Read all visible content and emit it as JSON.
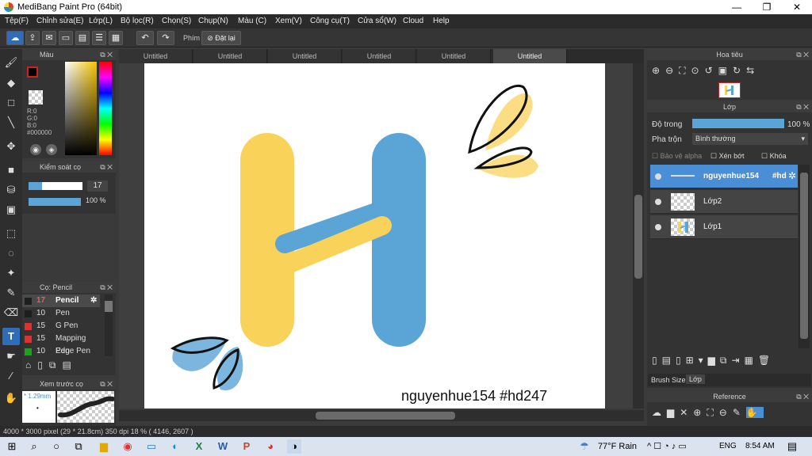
{
  "window": {
    "title": "MediBang Paint Pro (64bit)",
    "minimize": "—",
    "restore": "❐",
    "close": "✕"
  },
  "menu": [
    "Tệp(F)",
    "Chỉnh sửa(E)",
    "Lớp(L)",
    "Bộ lọc(R)",
    "Chọn(S)",
    "Chụp(N)",
    "Màu (C)",
    "Xem(V)",
    "Công cụ(T)",
    "Cửa sổ(W)",
    "Cloud",
    "Help"
  ],
  "toolbar": {
    "shortcut_label": "Phím",
    "reset_label": "Đặt lại"
  },
  "tabs": [
    "Untitled",
    "Untitled",
    "Untitled",
    "Untitled",
    "Untitled",
    "Untitled"
  ],
  "color_panel": {
    "title": "Màu",
    "r": "R:0",
    "g": "G:0",
    "b": "B:0",
    "hex": "#000000"
  },
  "brush_control": {
    "title": "Kiểm soát cọ",
    "size": "17",
    "opacity": "100 %",
    "size_fraction": 0.25,
    "opacity_fraction": 1.0
  },
  "brush_panel": {
    "title": "Cọ: Pencil",
    "items": [
      {
        "size": "17",
        "name": "Pencil",
        "color": "#1e1e1e",
        "selected": true
      },
      {
        "size": "10",
        "name": "Pen",
        "color": "#1e1e1e",
        "selected": false
      },
      {
        "size": "15",
        "name": "G Pen",
        "color": "#e03030",
        "selected": false
      },
      {
        "size": "15",
        "name": "Mapping Pen",
        "color": "#e03030",
        "selected": false
      },
      {
        "size": "10",
        "name": "Edge Pen",
        "color": "#20a020",
        "selected": false
      }
    ]
  },
  "preview_panel": {
    "title": "Xem trước cọ",
    "size": "1.29mm"
  },
  "canvas": {
    "caption": "nguyenhue154  #hd247"
  },
  "navigator": {
    "title": "Hoa tiêu"
  },
  "layer_panel": {
    "title": "Lớp",
    "opacity_label": "Độ trong",
    "opacity_value": "100 %",
    "opacity_fraction": 1.0,
    "blend_label": "Pha trộn",
    "blend_value": "Bình thường",
    "protect_alpha": "Bảo vệ alpha",
    "clipping": "Xén bớt",
    "lock": "Khóa",
    "layers": [
      {
        "name": "nguyenhue154",
        "tag": "#hd",
        "selected": true
      },
      {
        "name": "Lớp2",
        "selected": false
      },
      {
        "name": "Lớp1",
        "selected": false
      }
    ],
    "tab_brush_size": "Brush Size",
    "tab_layer": "Lớp"
  },
  "reference_panel": {
    "title": "Reference"
  },
  "status": "4000 * 3000 pixel  (29 * 21.8cm)  350 dpi  18 %  ( 4146, 2607 )",
  "taskbar": {
    "weather": "77°F  Rain",
    "lang": "ENG",
    "time": "8:54 AM"
  },
  "colors": {
    "yellow": "#f9d25a",
    "blue": "#5ba4d6",
    "accent": "#4a8fd6"
  }
}
